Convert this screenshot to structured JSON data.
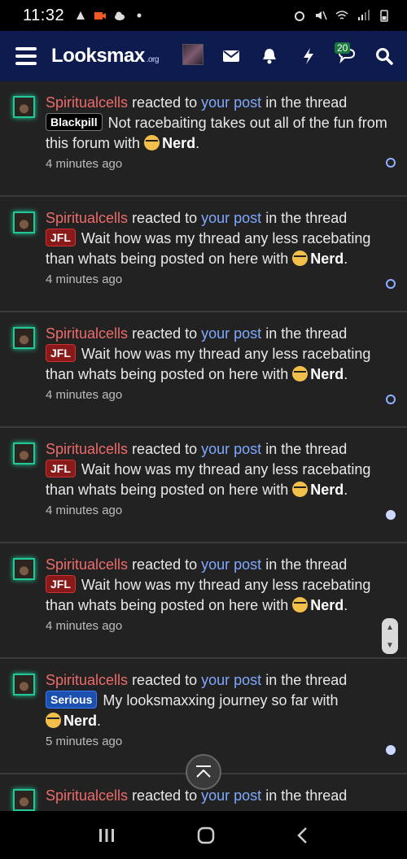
{
  "status_bar": {
    "time": "11:32"
  },
  "header": {
    "logo_main": "Looksmax",
    "logo_tld": ".org",
    "conversations_count": "20"
  },
  "notifications": [
    {
      "user": "Spiritualcells",
      "action": "reacted to",
      "post_link": "your post",
      "suffix": "in the thread",
      "prefix": "Blackpill",
      "prefix_style": "blackpill",
      "thread": "Not racebaiting takes out all of the fun from this forum",
      "with": "with",
      "reaction": "Nerd",
      "time": "4 minutes ago",
      "read": false
    },
    {
      "user": "Spiritualcells",
      "action": "reacted to",
      "post_link": "your post",
      "suffix": "in the thread",
      "prefix": "JFL",
      "prefix_style": "jfl",
      "thread": "Wait how was my thread any less racebating than whats being posted on here",
      "with": "with",
      "reaction": "Nerd",
      "time": "4 minutes ago",
      "read": false
    },
    {
      "user": "Spiritualcells",
      "action": "reacted to",
      "post_link": "your post",
      "suffix": "in the thread",
      "prefix": "JFL",
      "prefix_style": "jfl",
      "thread": "Wait how was my thread any less racebating than whats being posted on here",
      "with": "with",
      "reaction": "Nerd",
      "time": "4 minutes ago",
      "read": false
    },
    {
      "user": "Spiritualcells",
      "action": "reacted to",
      "post_link": "your post",
      "suffix": "in the thread",
      "prefix": "JFL",
      "prefix_style": "jfl",
      "thread": "Wait how was my thread any less racebating than whats being posted on here",
      "with": "with",
      "reaction": "Nerd",
      "time": "4 minutes ago",
      "read": true
    },
    {
      "user": "Spiritualcells",
      "action": "reacted to",
      "post_link": "your post",
      "suffix": "in the thread",
      "prefix": "JFL",
      "prefix_style": "jfl",
      "thread": "Wait how was my thread any less racebating than whats being posted on here",
      "with": "with",
      "reaction": "Nerd",
      "time": "4 minutes ago",
      "read": false
    },
    {
      "user": "Spiritualcells",
      "action": "reacted to",
      "post_link": "your post",
      "suffix": "in the thread",
      "prefix": "Serious",
      "prefix_style": "serious",
      "thread": "My looksmaxxing journey so far",
      "with": "with",
      "reaction": "Nerd",
      "time": "5 minutes ago",
      "read": true
    },
    {
      "user": "Spiritualcells",
      "action": "reacted to",
      "post_link": "your post",
      "suffix": "in the thread",
      "prefix": "",
      "prefix_style": "jfl",
      "thread": "",
      "with": "",
      "reaction": "",
      "time": "",
      "read": false
    }
  ],
  "colors": {
    "header_bg": "#0d1b4f",
    "username": "#ee6b6b",
    "link": "#7fa8ff",
    "avatar_ring": "#20c997"
  }
}
